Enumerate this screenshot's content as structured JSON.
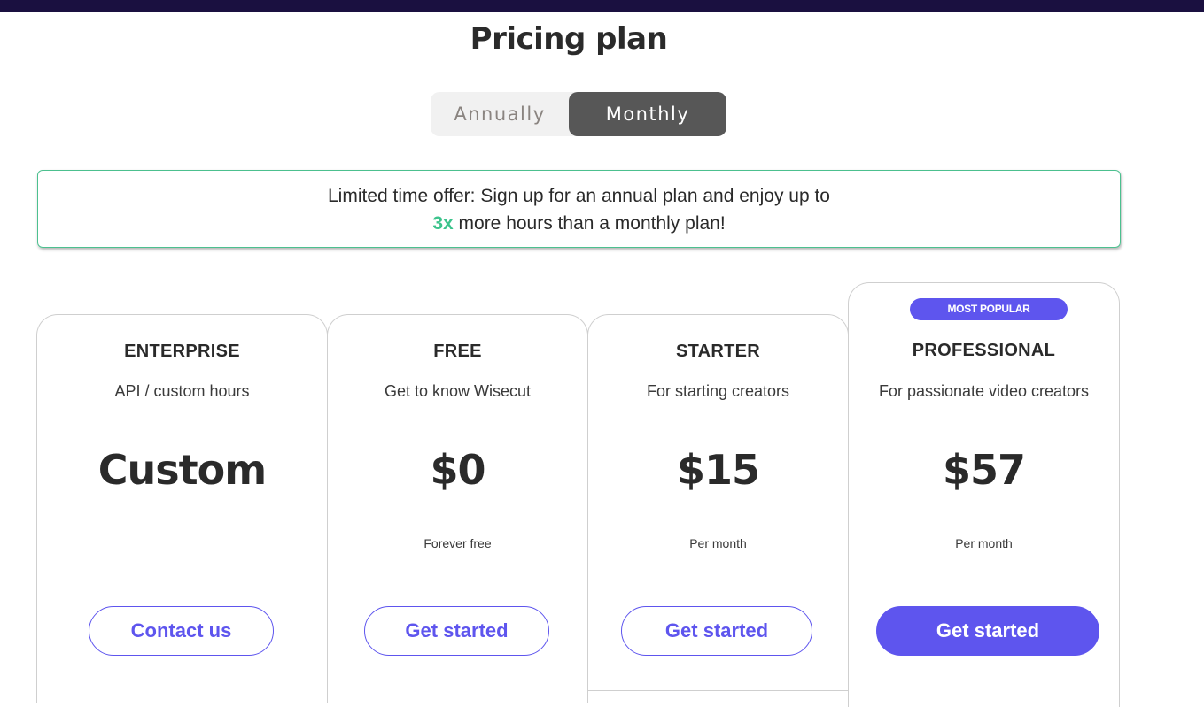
{
  "header": {
    "title": "Pricing plan"
  },
  "billing_toggle": {
    "options": [
      "Annually",
      "Monthly"
    ],
    "selected": "Monthly"
  },
  "offer_banner": {
    "text_line1": "Limited time offer: Sign up for an annual plan and enjoy up to",
    "highlight": "3x",
    "text_line2": "more hours than a monthly plan!",
    "highlight_color": "#3cc38c",
    "border_color": "#4cc08f"
  },
  "plans": [
    {
      "name": "ENTERPRISE",
      "description": "API / custom hours",
      "price": "Custom",
      "period": "",
      "cta": "Contact us",
      "badge": ""
    },
    {
      "name": "FREE",
      "description": "Get to know Wisecut",
      "price": "$0",
      "period": "Forever free",
      "cta": "Get started",
      "badge": ""
    },
    {
      "name": "STARTER",
      "description": "For starting creators",
      "price": "$15",
      "period": "Per month",
      "cta": "Get started",
      "badge": ""
    },
    {
      "name": "PROFESSIONAL",
      "description": "For passionate video creators",
      "price": "$57",
      "period": "Per month",
      "cta": "Get started",
      "badge": "MOST POPULAR"
    }
  ],
  "colors": {
    "accent": "#5e55ee",
    "topbar": "#1a1040",
    "toggle_active": "#575757"
  }
}
